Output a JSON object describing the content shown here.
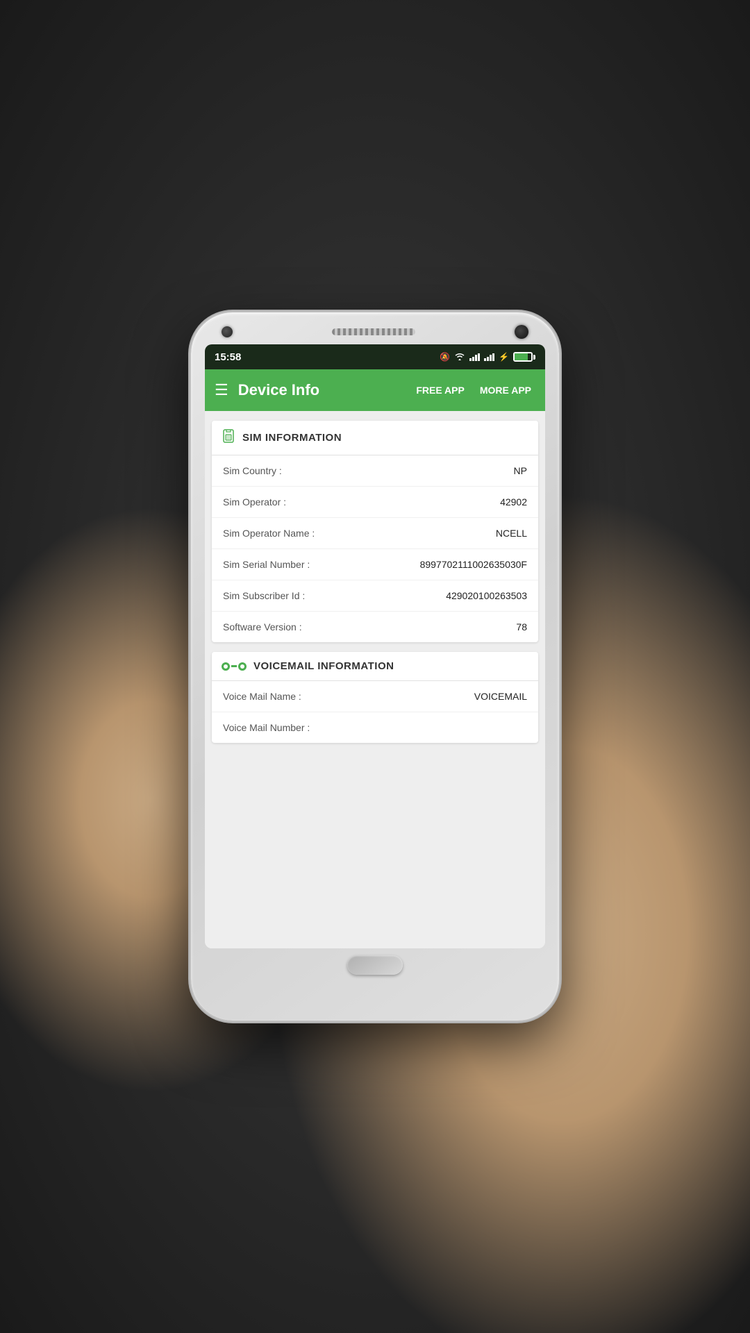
{
  "scene": {
    "status_bar": {
      "time": "15:58"
    },
    "app_bar": {
      "title": "Device Info",
      "free_app_label": "FREE APP",
      "more_app_label": "MORE APP"
    },
    "sections": [
      {
        "id": "sim",
        "title": "SIM INFORMATION",
        "icon_name": "sim-card-icon",
        "rows": [
          {
            "label": "Sim Country :",
            "value": "NP"
          },
          {
            "label": "Sim Operator :",
            "value": "42902"
          },
          {
            "label": "Sim Operator Name :",
            "value": "NCELL"
          },
          {
            "label": "Sim Serial Number :",
            "value": "8997702111002635030F"
          },
          {
            "label": "Sim Subscriber Id :",
            "value": "429020100263503"
          },
          {
            "label": "Software Version :",
            "value": "78"
          }
        ]
      },
      {
        "id": "voicemail",
        "title": "VOICEMAIL INFORMATION",
        "icon_name": "voicemail-icon",
        "rows": [
          {
            "label": "Voice Mail Name :",
            "value": "VOICEMAIL"
          },
          {
            "label": "Voice Mail Number :",
            "value": ""
          }
        ]
      }
    ]
  }
}
